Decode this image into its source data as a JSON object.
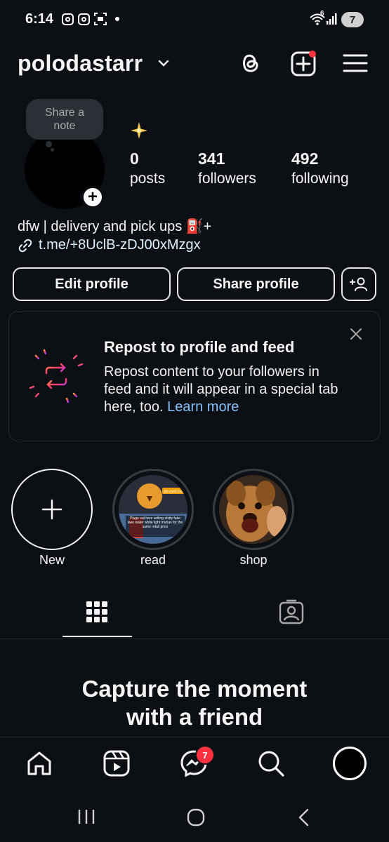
{
  "status_bar": {
    "time": "6:14",
    "battery": "7",
    "signal": "6"
  },
  "header": {
    "username": "polodastarr",
    "icons": [
      "threads-icon",
      "create-icon",
      "menu-icon"
    ],
    "has_notification": true
  },
  "profile": {
    "note_placeholder": "Share a note",
    "note_line1": "Share a",
    "note_line2": "note",
    "note_badge": "★",
    "stats": [
      {
        "value": "0",
        "label": "posts"
      },
      {
        "value": "341",
        "label": "followers"
      },
      {
        "value": "492",
        "label": "following"
      }
    ],
    "bio": "dfw | delivery and pick ups ⛽+",
    "link": "t.me/+8UclB-zDJ00xMzgx"
  },
  "actions": {
    "edit": "Edit profile",
    "share": "Share profile"
  },
  "repost_card": {
    "title": "Repost to profile and feed",
    "body": "Repost content to your followers in feed and it will appear in a special tab here, too.",
    "learn_more": "Learn more"
  },
  "highlights": [
    {
      "label": "New"
    },
    {
      "label": "read",
      "image_text": "Plugs out here selling shitty fake lake water white light muhas for the same retail price",
      "tag": "@crypticmuha"
    },
    {
      "label": "shop"
    }
  ],
  "empty_state": {
    "line1": "Capture the moment",
    "line2": "with a friend"
  },
  "bottom_nav": {
    "messages_badge": "7"
  },
  "colors": {
    "background": "#0c1014",
    "accent": "#ff3040",
    "link": "#85c2ff"
  }
}
